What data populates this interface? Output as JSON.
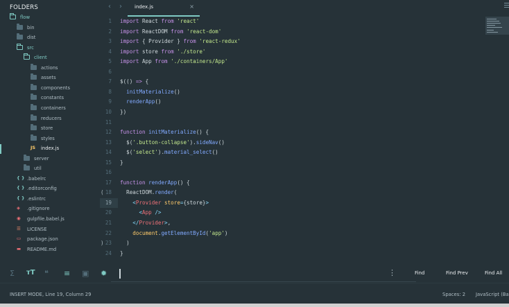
{
  "sidebar": {
    "header": "FOLDERS",
    "items": [
      {
        "label": "flow",
        "kind": "folder-open",
        "depth": 0
      },
      {
        "label": "bin",
        "kind": "folder",
        "depth": 1
      },
      {
        "label": "dist",
        "kind": "folder",
        "depth": 1
      },
      {
        "label": "src",
        "kind": "folder-open",
        "depth": 1
      },
      {
        "label": "client",
        "kind": "folder-open",
        "depth": 2
      },
      {
        "label": "actions",
        "kind": "folder",
        "depth": 3
      },
      {
        "label": "assets",
        "kind": "folder",
        "depth": 3
      },
      {
        "label": "components",
        "kind": "folder",
        "depth": 3
      },
      {
        "label": "constants",
        "kind": "folder",
        "depth": 3
      },
      {
        "label": "containers",
        "kind": "folder",
        "depth": 3
      },
      {
        "label": "reducers",
        "kind": "folder",
        "depth": 3
      },
      {
        "label": "store",
        "kind": "folder",
        "depth": 3
      },
      {
        "label": "styles",
        "kind": "folder",
        "depth": 3
      },
      {
        "label": "index.js",
        "kind": "js",
        "depth": 3,
        "active": true
      },
      {
        "label": "server",
        "kind": "folder",
        "depth": 2
      },
      {
        "label": "util",
        "kind": "folder",
        "depth": 2
      },
      {
        "label": ".babelrc",
        "kind": "json",
        "depth": 1
      },
      {
        "label": ".editorconfig",
        "kind": "config",
        "depth": 1
      },
      {
        "label": ".eslintrc",
        "kind": "json",
        "depth": 1
      },
      {
        "label": ".gitignore",
        "kind": "git",
        "depth": 1
      },
      {
        "label": "gulpfile.babel.js",
        "kind": "gulp",
        "depth": 1
      },
      {
        "label": "LICENSE",
        "kind": "text",
        "depth": 1
      },
      {
        "label": "package.json",
        "kind": "npm",
        "depth": 1
      },
      {
        "label": "README.md",
        "kind": "md",
        "depth": 1
      }
    ]
  },
  "tabbar": {
    "back_icon": "‹",
    "forward_icon": "›",
    "tab_name": "index.js",
    "close_icon": "×"
  },
  "editor": {
    "current_line": 19,
    "lines": [
      [
        [
          "kw",
          "import"
        ],
        [
          "t",
          " React "
        ],
        [
          "kw",
          "from"
        ],
        [
          "t",
          " "
        ],
        [
          "str",
          "'react'"
        ]
      ],
      [
        [
          "kw",
          "import"
        ],
        [
          "t",
          " ReactDOM "
        ],
        [
          "kw",
          "from"
        ],
        [
          "t",
          " "
        ],
        [
          "str",
          "'react-dom'"
        ]
      ],
      [
        [
          "kw",
          "import"
        ],
        [
          "t",
          " { Provider } "
        ],
        [
          "kw",
          "from"
        ],
        [
          "t",
          " "
        ],
        [
          "str",
          "'react-redux'"
        ]
      ],
      [
        [
          "kw",
          "import"
        ],
        [
          "t",
          " store "
        ],
        [
          "kw",
          "from"
        ],
        [
          "t",
          " "
        ],
        [
          "str",
          "'./store'"
        ]
      ],
      [
        [
          "kw",
          "import"
        ],
        [
          "t",
          " App "
        ],
        [
          "kw",
          "from"
        ],
        [
          "t",
          " "
        ],
        [
          "str",
          "'./containers/App'"
        ]
      ],
      [],
      [
        [
          "t",
          "$(() "
        ],
        [
          "kw",
          "=>"
        ],
        [
          "t",
          " {"
        ]
      ],
      [
        [
          "t",
          "  "
        ],
        [
          "fn",
          "initMaterialize"
        ],
        [
          "t",
          "()"
        ]
      ],
      [
        [
          "t",
          "  "
        ],
        [
          "fn",
          "renderApp"
        ],
        [
          "t",
          "()"
        ]
      ],
      [
        [
          "t",
          "})"
        ]
      ],
      [],
      [
        [
          "kw",
          "function"
        ],
        [
          "t",
          " "
        ],
        [
          "fn",
          "initMaterialize"
        ],
        [
          "t",
          "() {"
        ]
      ],
      [
        [
          "t",
          "  $("
        ],
        [
          "str",
          "'.button-collapse'"
        ],
        [
          "t",
          ")."
        ],
        [
          "fn",
          "sideNav"
        ],
        [
          "t",
          "()"
        ]
      ],
      [
        [
          "t",
          "  $("
        ],
        [
          "str",
          "'select'"
        ],
        [
          "t",
          ")."
        ],
        [
          "fn",
          "material_select"
        ],
        [
          "t",
          "()"
        ]
      ],
      [
        [
          "t",
          "}"
        ]
      ],
      [],
      [
        [
          "kw",
          "function"
        ],
        [
          "t",
          " "
        ],
        [
          "fn",
          "renderApp"
        ],
        [
          "t",
          "() {"
        ]
      ],
      [
        [
          "t",
          "  ReactDOM."
        ],
        [
          "fn",
          "render"
        ],
        [
          "t",
          "("
        ]
      ],
      [
        [
          "t",
          "    "
        ],
        [
          "punc",
          "<"
        ],
        [
          "tag",
          "Provider"
        ],
        [
          "t",
          " "
        ],
        [
          "attr",
          "store"
        ],
        [
          "punc",
          "="
        ],
        [
          "t",
          "{store}"
        ],
        [
          "punc",
          ">"
        ]
      ],
      [
        [
          "t",
          "      "
        ],
        [
          "punc",
          "<"
        ],
        [
          "tag",
          "App"
        ],
        [
          "t",
          " "
        ],
        [
          "punc",
          "/>"
        ]
      ],
      [
        [
          "t",
          "    "
        ],
        [
          "punc",
          "</"
        ],
        [
          "tag",
          "Provider"
        ],
        [
          "punc",
          ">"
        ],
        [
          "t",
          ","
        ]
      ],
      [
        [
          "t",
          "    "
        ],
        [
          "attr",
          "document"
        ],
        [
          "t",
          "."
        ],
        [
          "fn",
          "getElementById"
        ],
        [
          "t",
          "("
        ],
        [
          "str",
          "'app'"
        ],
        [
          "t",
          ")"
        ]
      ],
      [
        [
          "t",
          "  )"
        ]
      ],
      [
        [
          "t",
          "}"
        ]
      ]
    ],
    "fold_open_marker": "(",
    "fold_close_marker": ")"
  },
  "findbar": {
    "icons": [
      "regex-icon",
      "case-icon",
      "whole-word-icon",
      "wrap-icon",
      "in-selection-icon",
      "highlight-icon"
    ],
    "input_value": "",
    "find_label": "Find",
    "find_prev_label": "Find Prev",
    "find_all_label": "Find All",
    "more_icon": "⋮"
  },
  "statusbar": {
    "mode": "INSERT MODE, Line 19, Column 29",
    "spaces": "Spaces: 2",
    "syntax": "JavaScript (Babel)"
  }
}
